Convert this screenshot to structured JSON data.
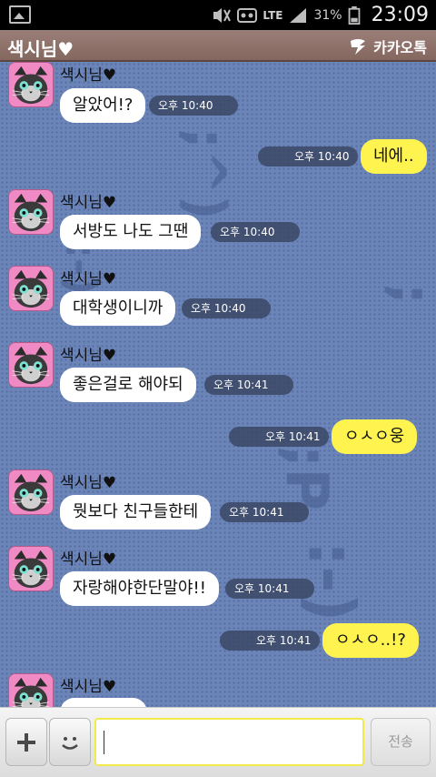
{
  "status_bar": {
    "network": "LTE",
    "battery": "31%",
    "time": "23:09"
  },
  "header": {
    "title": "색시님♥",
    "brand": "카카오톡"
  },
  "messages": [
    {
      "dir": "in",
      "sender": "색시님♥",
      "text": "알았어!?",
      "time": "오후 10:40",
      "sender_hidden": true
    },
    {
      "dir": "out",
      "text": "네에..",
      "time": "오후 10:40"
    },
    {
      "dir": "in",
      "sender": "색시님♥",
      "text": "서방도 나도 그땐",
      "time": "오후 10:40"
    },
    {
      "dir": "in",
      "sender": "색시님♥",
      "text": "대학생이니까",
      "time": "오후 10:40"
    },
    {
      "dir": "in",
      "sender": "색시님♥",
      "text": "좋은걸로 해야되",
      "time": "오후 10:41"
    },
    {
      "dir": "out",
      "text": "ㅇㅅㅇ웅",
      "time": "오후 10:41"
    },
    {
      "dir": "in",
      "sender": "색시님♥",
      "text": "뭣보다 친구들한테",
      "time": "오후 10:41"
    },
    {
      "dir": "in",
      "sender": "색시님♥",
      "text": "자랑해야한단말야!!",
      "time": "오후 10:41"
    },
    {
      "dir": "out",
      "text": "ㅇㅅㅇ..!?",
      "time": "오후 10:41"
    },
    {
      "dir": "in",
      "sender": "색시님♥",
      "text": "",
      "time": ""
    }
  ],
  "input_bar": {
    "message_value": "",
    "send_label": "전송"
  },
  "colors": {
    "chat_background": "#6b85b8",
    "incoming_bubble": "#ffffff",
    "outgoing_bubble": "#fff44f",
    "header_background": "#8f746c"
  }
}
